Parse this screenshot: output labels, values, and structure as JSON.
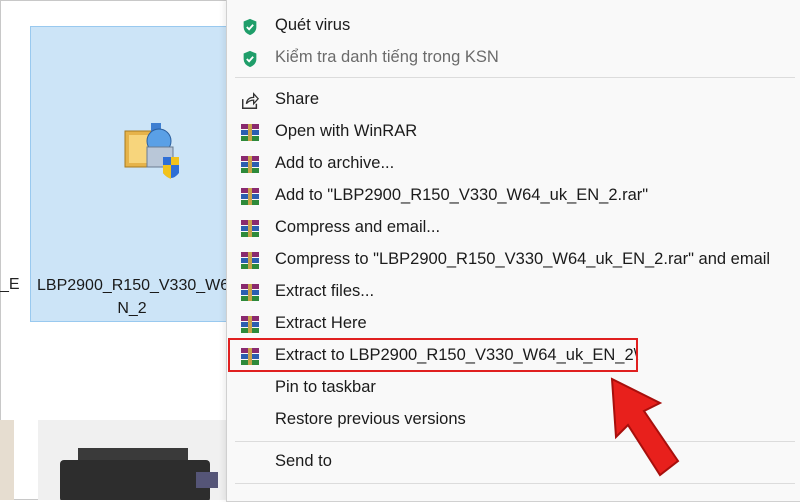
{
  "explorer": {
    "edge_label": "_E",
    "file_name_line1": "LBP2900_R150_V330_W6",
    "file_name_line2": "N_2"
  },
  "menu": {
    "items": [
      {
        "label": "Quét virus",
        "icon": "shield-check-icon"
      },
      {
        "label": "Kiểm tra danh tiếng trong KSN",
        "icon": "shield-check-icon"
      },
      {
        "label": "Share",
        "icon": "share-icon"
      },
      {
        "label": "Open with WinRAR",
        "icon": "winrar-icon"
      },
      {
        "label": "Add to archive...",
        "icon": "winrar-icon"
      },
      {
        "label": "Add to \"LBP2900_R150_V330_W64_uk_EN_2.rar\"",
        "icon": "winrar-icon"
      },
      {
        "label": "Compress and email...",
        "icon": "winrar-icon"
      },
      {
        "label": "Compress to \"LBP2900_R150_V330_W64_uk_EN_2.rar\" and email",
        "icon": "winrar-icon"
      },
      {
        "label": "Extract files...",
        "icon": "winrar-icon"
      },
      {
        "label": "Extract Here",
        "icon": "winrar-icon"
      },
      {
        "label": "Extract to LBP2900_R150_V330_W64_uk_EN_2\\",
        "icon": "winrar-icon"
      },
      {
        "label": "Pin to taskbar",
        "icon": ""
      },
      {
        "label": "Restore previous versions",
        "icon": ""
      },
      {
        "label": "Send to",
        "icon": ""
      }
    ]
  },
  "colors": {
    "selection": "#cce4f7",
    "highlight_box": "#e02020",
    "arrow": "#e8201c",
    "shield": "#1f9e6a"
  }
}
